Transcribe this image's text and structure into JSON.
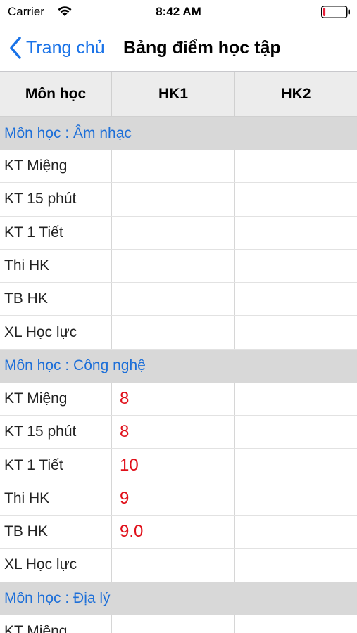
{
  "status_bar": {
    "carrier": "Carrier",
    "time": "8:42 AM",
    "wifi_icon": "wifi-icon",
    "battery_icon": "battery-low-icon",
    "battery_level": 0.1
  },
  "nav": {
    "back_label": "Trang chủ",
    "back_icon": "chevron-left-icon",
    "title": "Bảng điểm học tập",
    "accent_color": "#1a73e8"
  },
  "table": {
    "headers": [
      "Môn học",
      "HK1",
      "HK2"
    ],
    "sections": [
      {
        "title": "Môn học : Âm nhạc",
        "rows": [
          {
            "label": "KT Miệng",
            "hk1": "",
            "hk2": ""
          },
          {
            "label": "KT 15 phút",
            "hk1": "",
            "hk2": ""
          },
          {
            "label": "KT 1 Tiết",
            "hk1": "",
            "hk2": ""
          },
          {
            "label": "Thi HK",
            "hk1": "",
            "hk2": ""
          },
          {
            "label": "TB HK",
            "hk1": "",
            "hk2": ""
          },
          {
            "label": "XL Học lực",
            "hk1": "",
            "hk2": ""
          }
        ]
      },
      {
        "title": "Môn học : Công nghệ",
        "rows": [
          {
            "label": "KT Miệng",
            "hk1": "8",
            "hk2": ""
          },
          {
            "label": "KT 15 phút",
            "hk1": "8",
            "hk2": ""
          },
          {
            "label": "KT 1 Tiết",
            "hk1": "10",
            "hk2": ""
          },
          {
            "label": "Thi HK",
            "hk1": "9",
            "hk2": ""
          },
          {
            "label": "TB HK",
            "hk1": "9.0",
            "hk2": ""
          },
          {
            "label": "XL Học lực",
            "hk1": "",
            "hk2": ""
          }
        ]
      },
      {
        "title": "Môn học : Địa lý",
        "rows": [
          {
            "label": "KT Miệng",
            "hk1": "",
            "hk2": ""
          }
        ]
      }
    ]
  }
}
